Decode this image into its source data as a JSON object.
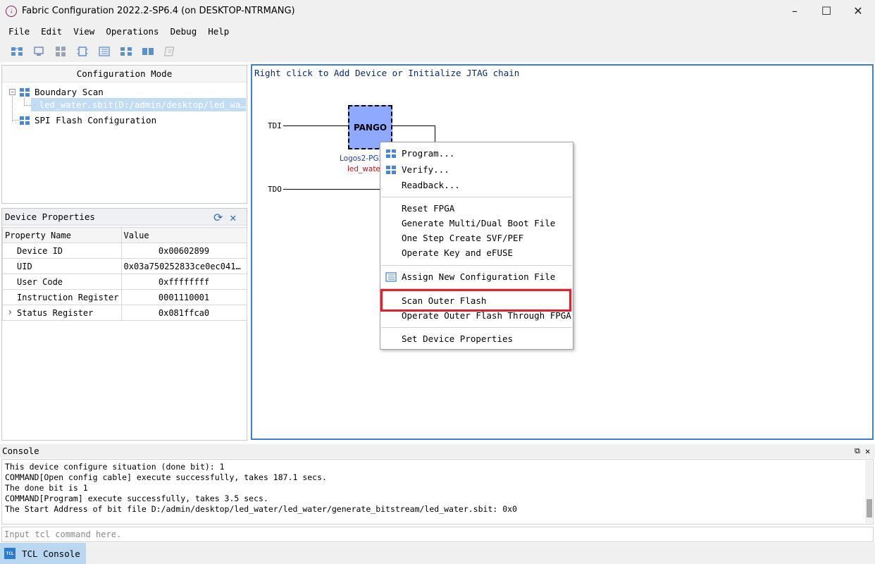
{
  "window": {
    "title": "Fabric Configuration 2022.2-SP6.4 (on DESKTOP-NTRMANG)",
    "minimize": "–",
    "maximize": "☐",
    "close": "✕"
  },
  "menu": [
    "File",
    "Edit",
    "View",
    "Operations",
    "Debug",
    "Help"
  ],
  "toolbar": {
    "icons": [
      "boundary-scan-icon",
      "monitor-icon",
      "grid-icon",
      "chip-icon",
      "list-icon",
      "chain-icon",
      "chain-alt-icon",
      "file-disabled-icon"
    ]
  },
  "tree": {
    "header": "Configuration Mode",
    "boundary_scan": "Boundary Scan",
    "file_node": "led_water.sbit(D:/admin/desktop/led_wa…",
    "spi_flash": "SPI Flash Configuration"
  },
  "device_properties": {
    "title": "Device Properties",
    "col_name": "Property Name",
    "col_value": "Value",
    "rows": [
      {
        "name": "Device ID",
        "value": "0x00602899"
      },
      {
        "name": "UID",
        "value": "0x03a750252833ce0ec0411…"
      },
      {
        "name": "User Code",
        "value": "0xffffffff"
      },
      {
        "name": "Instruction Register",
        "value": "0001110001"
      },
      {
        "name": "Status Register",
        "value": "0x081ffca0"
      }
    ],
    "expand_glyph": "›"
  },
  "canvas": {
    "hint": "Right click to Add Device or Initialize JTAG chain",
    "tdi": "TDI",
    "tdo": "TDO",
    "chip_label": "PANGO",
    "chip_model": "Logos2-PG2",
    "chip_file": "led_water."
  },
  "context_menu": {
    "program": "Program...",
    "verify": "Verify...",
    "readback": "Readback...",
    "reset_fpga": "Reset FPGA",
    "gen_boot": "Generate Multi/Dual Boot File",
    "one_step": "One Step Create SVF/PEF",
    "key_efuse": "Operate Key and eFUSE",
    "assign_cfg": "Assign New Configuration File",
    "scan_flash": "Scan Outer Flash",
    "operate_flash": "Operate Outer Flash Through FPGA",
    "set_props": "Set Device Properties",
    "highlight_color": "#e0202a"
  },
  "console": {
    "title": "Console",
    "lines": [
      "This device configure situation (done bit): 1",
      "COMMAND[Open config cable] execute successfully, takes 187.1 secs.",
      "The done bit is 1",
      "COMMAND[Program] execute successfully, takes 3.5 secs.",
      "The Start Address of bit file D:/admin/desktop/led_water/led_water/generate_bitstream/led_water.sbit: 0x0"
    ],
    "input_placeholder": "Input tcl command here.",
    "tab_label": "TCL Console",
    "tab_icon_text": "TCL"
  }
}
